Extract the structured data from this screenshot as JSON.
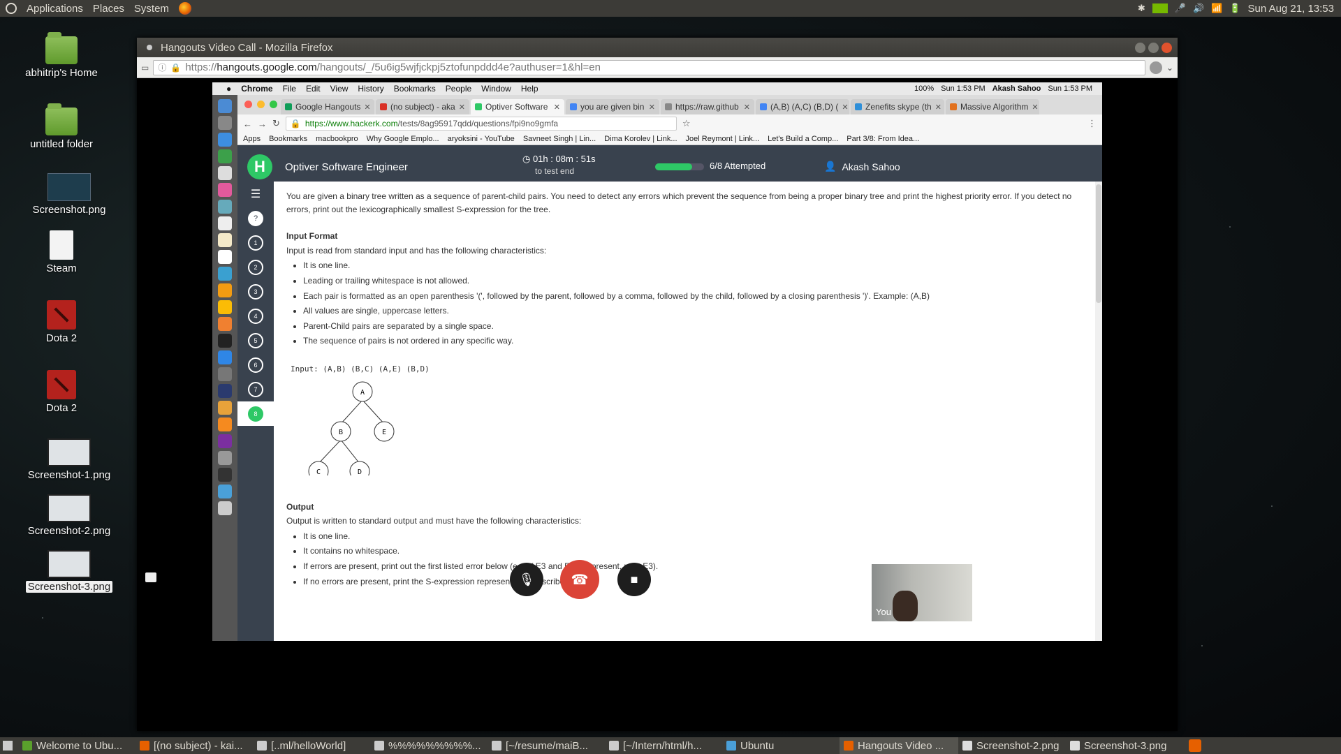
{
  "top_panel": {
    "menus": [
      "Applications",
      "Places",
      "System"
    ],
    "datetime": "Sun Aug 21, 13:53"
  },
  "desktop_icons": [
    {
      "label": "abhitrip's Home",
      "kind": "home"
    },
    {
      "label": "untitled folder",
      "kind": "folder"
    },
    {
      "label": "Screenshot.png",
      "kind": "image-dark"
    },
    {
      "label": "Steam",
      "kind": "doc"
    },
    {
      "label": "Dota 2",
      "kind": "dota"
    },
    {
      "label": "Dota 2",
      "kind": "dota"
    },
    {
      "label": "Screenshot-1.png",
      "kind": "image-light"
    },
    {
      "label": "Screenshot-2.png",
      "kind": "image-light"
    },
    {
      "label": "Screenshot-3.png",
      "kind": "image-light",
      "selected": true
    }
  ],
  "firefox": {
    "title": "Hangouts Video Call - Mozilla Firefox",
    "url_prefix": "https://",
    "url_host": "hangouts.google.com",
    "url_rest": "/hangouts/_/5u6ig5wjfjckpj5ztofunpddd4e?authuser=1&hl=en"
  },
  "mac": {
    "menubar": [
      "Chrome",
      "File",
      "Edit",
      "View",
      "History",
      "Bookmarks",
      "People",
      "Window",
      "Help"
    ],
    "battery": "100%",
    "time": "Sun 1:53 PM",
    "user": "Akash Sahoo",
    "time2": "Sun 1:53 PM"
  },
  "chrome": {
    "tabs": [
      {
        "label": "Google Hangouts",
        "color": "#0f9d58",
        "active": false
      },
      {
        "label": "(no subject) - aka",
        "color": "#d93025",
        "active": false
      },
      {
        "label": "Optiver Software",
        "color": "#2ec866",
        "active": true
      },
      {
        "label": "you are given bin",
        "color": "#4285f4",
        "active": false
      },
      {
        "label": "https://raw.github",
        "color": "#888888",
        "active": false
      },
      {
        "label": "(A,B) (A,C) (B,D) (",
        "color": "#4285f4",
        "active": false
      },
      {
        "label": "Zenefits skype (th",
        "color": "#2f8fd8",
        "active": false
      },
      {
        "label": "Massive Algorithm",
        "color": "#e2711d",
        "active": false
      }
    ],
    "url_host": "https://www.hacker",
    "url_host_tail": "k.com",
    "url_rest": "/tests/8ag95917qdd/questions/fpi9no9gmfa",
    "bookmarks": [
      "Apps",
      "Bookmarks",
      "macbookpro",
      "Why Google Emplo...",
      "aryoksini - YouTube",
      "Savneet Singh | Lin...",
      "Dima Korolev | Link...",
      "Joel Reymont | Link...",
      "Let's Build a Comp...",
      "Part 3/8: From Idea..."
    ]
  },
  "hackerrank": {
    "logo": "H",
    "test_title": "Optiver Software Engineer",
    "timer": "01h : 08m : 51s",
    "timer_sub": "to test end",
    "progress": 0.75,
    "attempted": "6/8 Attempted",
    "user": "Akash Sahoo",
    "questions": [
      "1",
      "2",
      "3",
      "4",
      "5",
      "6",
      "7",
      "8"
    ],
    "current_question": 8,
    "intro": "You are given a binary tree written as a sequence of parent-child pairs. You need to detect any errors which prevent the sequence from being a proper binary tree and print the highest priority error. If you detect no errors, print out the lexicographically smallest S-expression for the tree.",
    "input_heading": "Input Format",
    "input_desc": "Input is read from standard input and has the following characteristics:",
    "input_items": [
      "It is one line.",
      "Leading or trailing whitespace is not allowed.",
      "Each pair is formatted as an open parenthesis '(', followed by the parent, followed by a comma, followed by the child, followed by a closing parenthesis ')'. Example: (A,B)",
      "All values are single, uppercase letters.",
      "Parent-Child pairs are separated by a single space.",
      "The sequence of pairs is not ordered in any specific way."
    ],
    "example_label": "Input:",
    "example_input": "(A,B) (B,C) (A,E) (B,D)",
    "tree_nodes": [
      "A",
      "B",
      "E",
      "C",
      "D"
    ],
    "output_heading": "Output",
    "output_desc": "Output is written to standard output and must have the following characteristics:",
    "output_items": [
      "It is one line.",
      "It contains no whitespace.",
      "If errors are present, print out the first listed error below (e.g. if E3 and E4 are present, print E3).",
      "If no errors are present, print the S-expression representation described below."
    ]
  },
  "hangouts": {
    "self_label": "You"
  },
  "taskbar": [
    {
      "label": "Welcome to Ubu...",
      "color": "#5aa02c",
      "active": false
    },
    {
      "label": "[(no subject) - kai...",
      "color": "#e66000",
      "active": false
    },
    {
      "label": "[..ml/helloWorld]",
      "color": "#cccccc",
      "active": false
    },
    {
      "label": "%%%%%%%%%...",
      "color": "#cccccc",
      "active": false
    },
    {
      "label": "[~/resume/maiB...",
      "color": "#cccccc",
      "active": false
    },
    {
      "label": "[~/Intern/html/h...",
      "color": "#cccccc",
      "active": false
    },
    {
      "label": "Ubuntu",
      "color": "#4a9fd8",
      "active": false
    },
    {
      "label": "Hangouts Video ...",
      "color": "#e66000",
      "active": true
    },
    {
      "label": "Screenshot-2.png",
      "color": "#dddddd",
      "active": false
    },
    {
      "label": "Screenshot-3.png",
      "color": "#dddddd",
      "active": false
    }
  ]
}
